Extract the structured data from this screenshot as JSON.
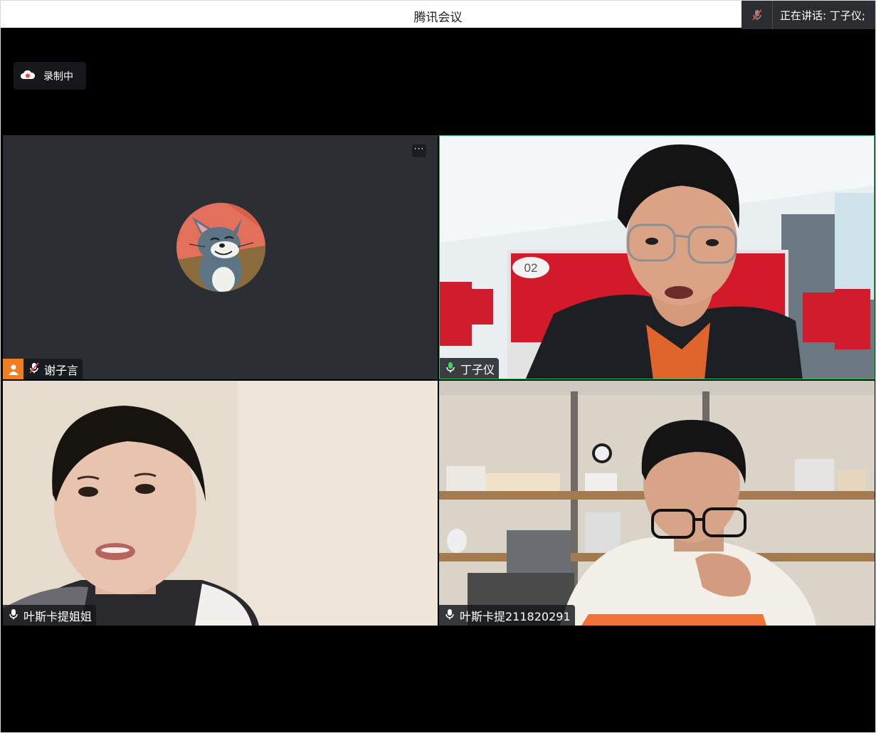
{
  "window": {
    "title": "腾讯会议"
  },
  "speaking_indicator": {
    "text": "正在讲话: 丁子仪;",
    "icon": "mic-muted-icon"
  },
  "recording": {
    "label": "录制中",
    "icon": "cloud-record-icon"
  },
  "participants": [
    {
      "name": "谢子言",
      "mic": "muted",
      "video": "off",
      "is_host": true,
      "icon": "tom-cat-avatar"
    },
    {
      "name": "丁子仪",
      "mic": "speaking",
      "video": "on",
      "active_speaker": true,
      "sign": "02"
    },
    {
      "name": "叶斯卡提姐姐",
      "mic": "on",
      "video": "on"
    },
    {
      "name": "叶斯卡提211820291",
      "mic": "on",
      "video": "on"
    }
  ],
  "colors": {
    "active_border": "#28c261",
    "host_badge": "#f07d22",
    "tile_bg": "#2b2e33"
  }
}
